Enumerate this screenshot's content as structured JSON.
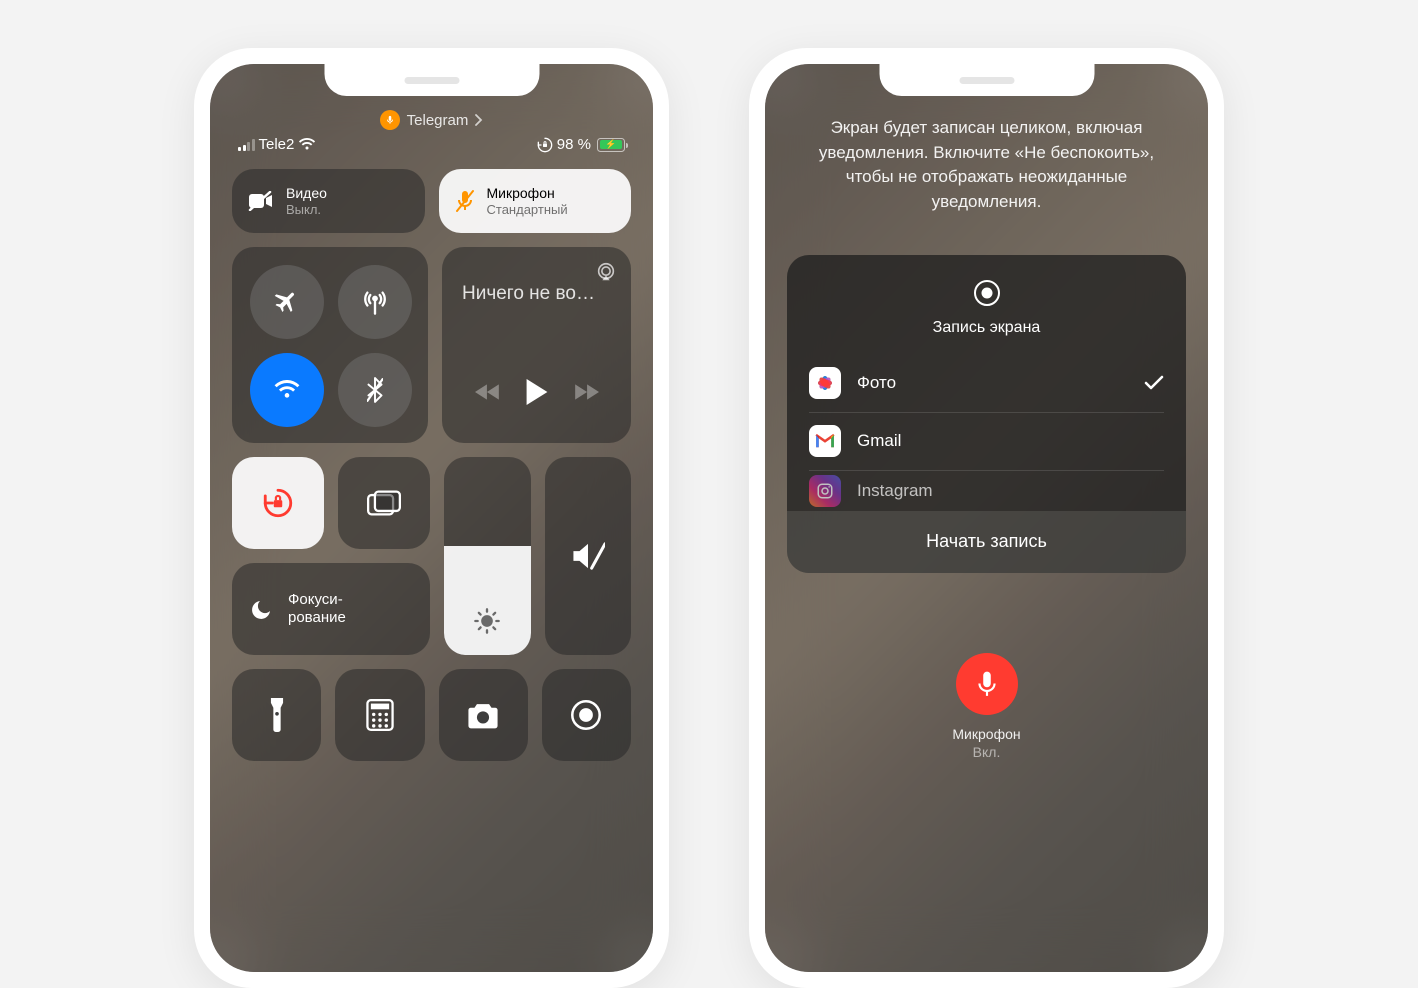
{
  "phone1": {
    "app_indicator": "Telegram",
    "carrier": "Tele2",
    "battery": "98 %",
    "video": {
      "title": "Видео",
      "sub": "Выкл."
    },
    "mic": {
      "title": "Микрофон",
      "sub": "Стандартный"
    },
    "media": {
      "title": "Ничего не во…"
    },
    "focus": "Фокуси-\nрование"
  },
  "phone2": {
    "info": "Экран будет записан целиком, включая уведомления. Включите «Не беспокоить», чтобы не отображать неожиданные уведомления.",
    "panel_title": "Запись экрана",
    "apps": [
      {
        "name": "Фото",
        "selected": true
      },
      {
        "name": "Gmail",
        "selected": false
      },
      {
        "name": "Instagram",
        "selected": false
      }
    ],
    "start": "Начать запись",
    "mic_label": "Микрофон",
    "mic_state": "Вкл."
  }
}
